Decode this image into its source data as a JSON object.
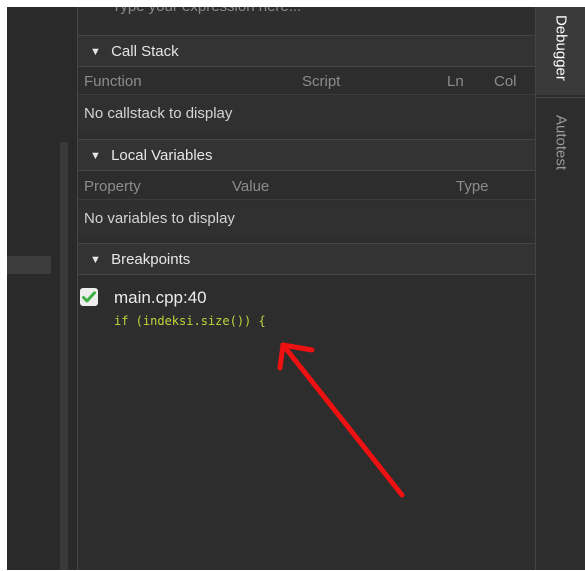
{
  "watch": {
    "placeholder": "Type your expression here..."
  },
  "call_stack": {
    "title": "Call Stack",
    "columns": [
      "Function",
      "Script",
      "Ln",
      "Col"
    ],
    "empty_text": "No callstack to display"
  },
  "local_variables": {
    "title": "Local Variables",
    "columns": [
      "Property",
      "Value",
      "Type"
    ],
    "empty_text": "No variables to display"
  },
  "breakpoints": {
    "title": "Breakpoints",
    "items": [
      {
        "file": "main.cpp:40",
        "code": "if (indeksi.size()) {",
        "enabled": true
      }
    ]
  },
  "right_tabs": [
    "Debugger",
    "Autotest"
  ],
  "colors": {
    "accent_check": "#3cb043",
    "code_text": "#c2d33b",
    "annotation_arrow": "#ee1111"
  }
}
